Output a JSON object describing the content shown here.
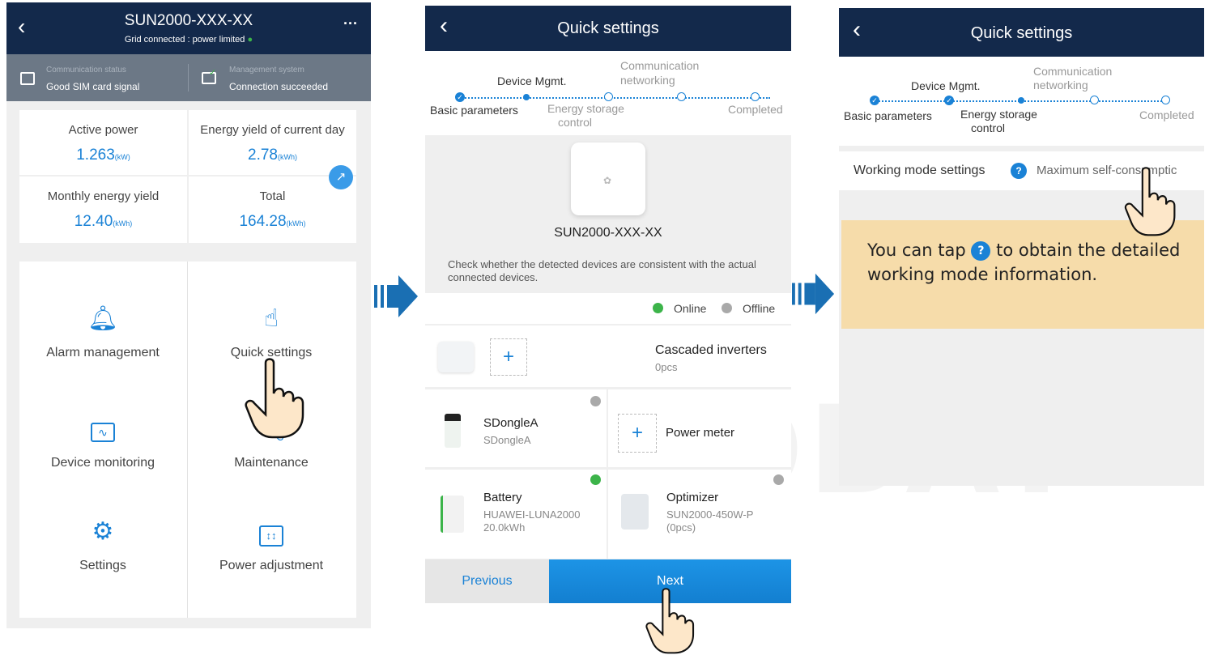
{
  "screen1": {
    "title": "SUN2000-XXX-XX",
    "subtitle": "Grid connected : power limited",
    "comm_status_label": "Communication status",
    "comm_status_value": "Good SIM card signal",
    "mgmt_label": "Management system",
    "mgmt_value": "Connection succeeded",
    "stats": [
      {
        "label": "Active power",
        "value": "1.263",
        "unit": "(kW)"
      },
      {
        "label": "Energy yield of current day",
        "value": "2.78",
        "unit": "(kWh)"
      },
      {
        "label": "Monthly energy yield",
        "value": "12.40",
        "unit": "(kWh)"
      },
      {
        "label": "Total",
        "value": "164.28",
        "unit": "(kWh)"
      }
    ],
    "menu": [
      {
        "label": "Alarm management",
        "icon": "bell-icon"
      },
      {
        "label": "Quick settings",
        "icon": "tap-icon"
      },
      {
        "label": "Device monitoring",
        "icon": "monitor-icon"
      },
      {
        "label": "Maintenance",
        "icon": "wrench-icon"
      },
      {
        "label": "Settings",
        "icon": "gear-icon"
      },
      {
        "label": "Power adjustment",
        "icon": "sliders-icon"
      }
    ]
  },
  "screen2": {
    "title": "Quick settings",
    "steps": {
      "basic": "Basic parameters",
      "device": "Device Mgmt.",
      "energy1": "Energy storage",
      "energy2": "control",
      "comm1": "Communication",
      "comm2": "networking",
      "completed": "Completed"
    },
    "device_name": "SUN2000-XXX-XX",
    "check_text": "Check whether the detected devices are consistent with the actual connected devices.",
    "online": "Online",
    "offline": "Offline",
    "cascaded_title": "Cascaded inverters",
    "cascaded_count": "0pcs",
    "sdongle_title": "SDongleA",
    "sdongle_sub": "SDongleA",
    "power_meter": "Power meter",
    "battery_title": "Battery",
    "battery_sub1": "HUAWEI-LUNA2000",
    "battery_sub2": "20.0kWh",
    "optimizer_title": "Optimizer",
    "optimizer_sub1": "SUN2000-450W-P",
    "optimizer_sub2": "(0pcs)",
    "previous": "Previous",
    "next": "Next"
  },
  "screen3": {
    "title": "Quick settings",
    "working_mode_label": "Working mode settings",
    "working_mode_value": "Maximum self-consumptic",
    "tip_part1": "You can tap",
    "tip_part2": "to obtain the detailed working mode information.",
    "help_glyph": "?"
  },
  "colors": {
    "navy": "#13294b",
    "accent": "#1a82d6",
    "online": "#3cb44a",
    "tip_bg": "#f6dcaa"
  }
}
